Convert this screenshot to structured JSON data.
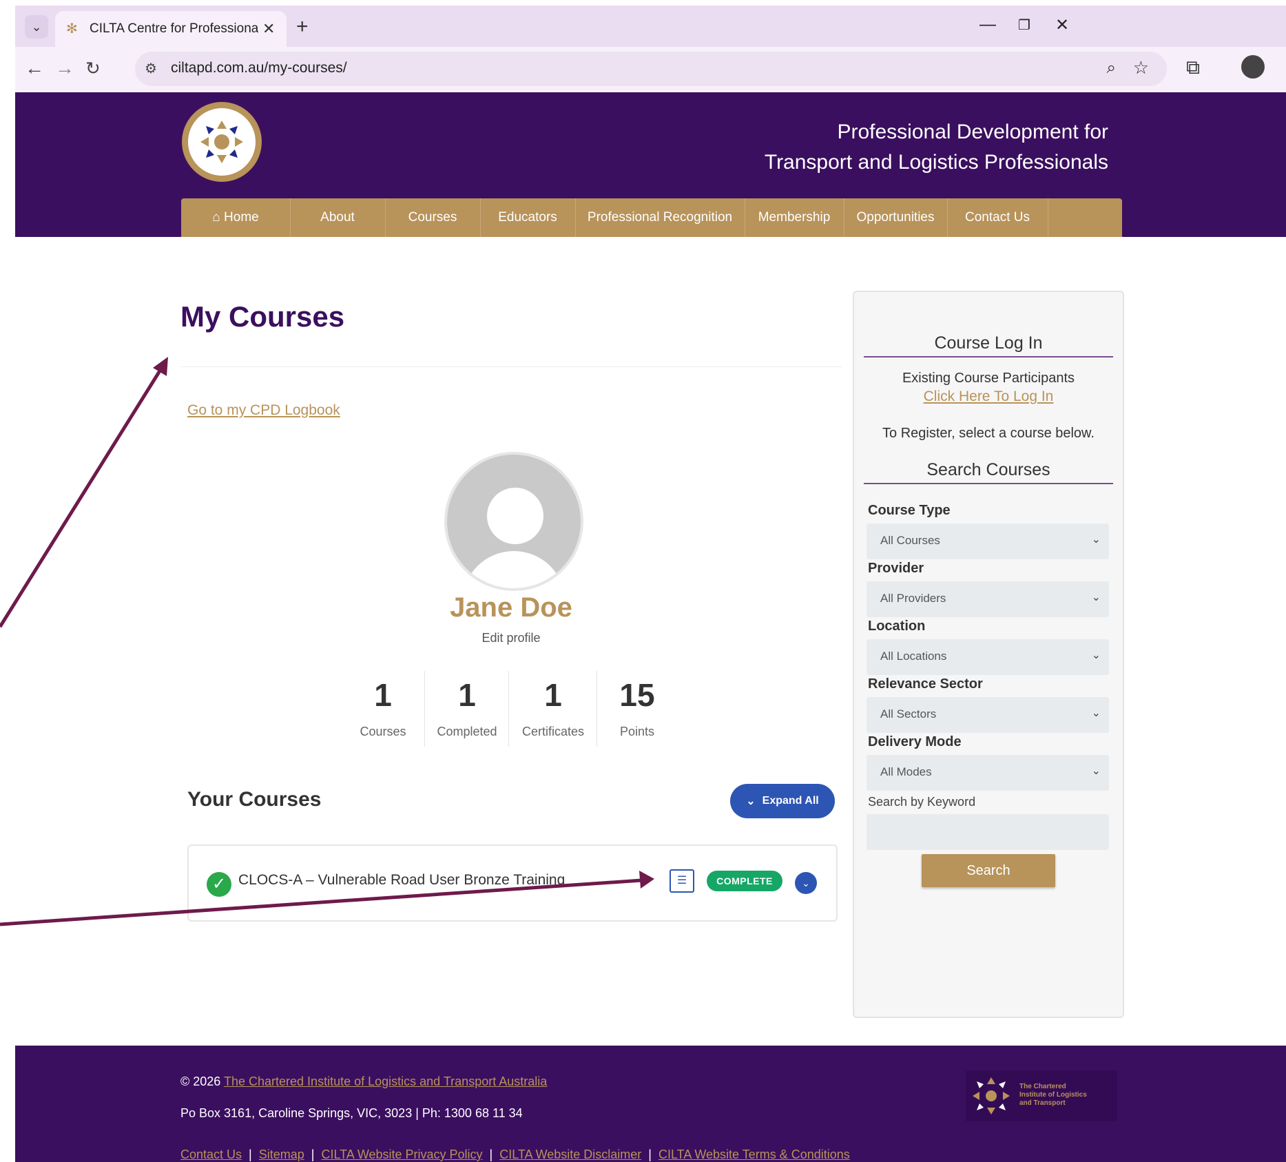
{
  "browser": {
    "tab_title": "CILTA Centre for Professional D",
    "url": "ciltapd.com.au/my-courses/"
  },
  "header": {
    "tagline_line1": "Professional Development for",
    "tagline_line2": "Transport and Logistics Professionals",
    "nav": [
      "Home",
      "About",
      "Courses",
      "Educators",
      "Professional Recognition",
      "Membership",
      "Opportunities",
      "Contact Us"
    ]
  },
  "main": {
    "title": "My Courses",
    "cpd_link": "Go to my CPD Logbook",
    "profile": {
      "name": "Jane Doe",
      "edit_label": "Edit profile"
    },
    "stats": [
      {
        "value": "1",
        "label": "Courses"
      },
      {
        "value": "1",
        "label": "Completed"
      },
      {
        "value": "1",
        "label": "Certificates"
      },
      {
        "value": "15",
        "label": "Points"
      }
    ],
    "your_courses_heading": "Your Courses",
    "expand_all_label": "Expand All",
    "courses": [
      {
        "name": "CLOCS-A – Vulnerable Road User Bronze Training",
        "status": "COMPLETE"
      }
    ]
  },
  "sidebar": {
    "login_heading": "Course Log In",
    "existing_text": "Existing Course Participants",
    "login_link": "Click Here To Log In",
    "register_text": "To Register, select a course below.",
    "search_heading": "Search Courses",
    "filters": [
      {
        "label": "Course Type",
        "value": "All Courses"
      },
      {
        "label": "Provider",
        "value": "All Providers"
      },
      {
        "label": "Location",
        "value": "All Locations"
      },
      {
        "label": "Relevance Sector",
        "value": "All Sectors"
      },
      {
        "label": "Delivery Mode",
        "value": "All Modes"
      }
    ],
    "keyword_label": "Search by Keyword",
    "keyword_value": "",
    "search_button": "Search"
  },
  "footer": {
    "copyright_prefix": "© 2026",
    "copyright_link": "The Chartered Institute of Logistics and Transport Australia",
    "address": "Po Box 3161, Caroline Springs, VIC, 3023 | Ph: 1300 68 11 34",
    "links": [
      "Contact Us",
      "Sitemap",
      "CILTA Website Privacy Policy",
      "CILTA Website Disclaimer",
      "CILTA Website Terms & Conditions"
    ],
    "logo_text_1": "The Chartered",
    "logo_text_2": "Institute of Logistics",
    "logo_text_3": "and Transport"
  },
  "colors": {
    "brand_purple": "#3b0f5f",
    "brand_gold": "#b8935a",
    "complete_green": "#16a766",
    "action_blue": "#2d55b4",
    "annotation_arrow": "#6e1a4b"
  },
  "icons": [
    "tab-search-icon",
    "close-icon",
    "plus-icon",
    "back-icon",
    "forward-icon",
    "reload-icon",
    "site-info-icon",
    "zoom-icon",
    "star-icon",
    "extensions-icon",
    "profile-icon",
    "more-icon",
    "home-icon",
    "check-icon",
    "certificate-icon",
    "chevron-down-icon"
  ]
}
